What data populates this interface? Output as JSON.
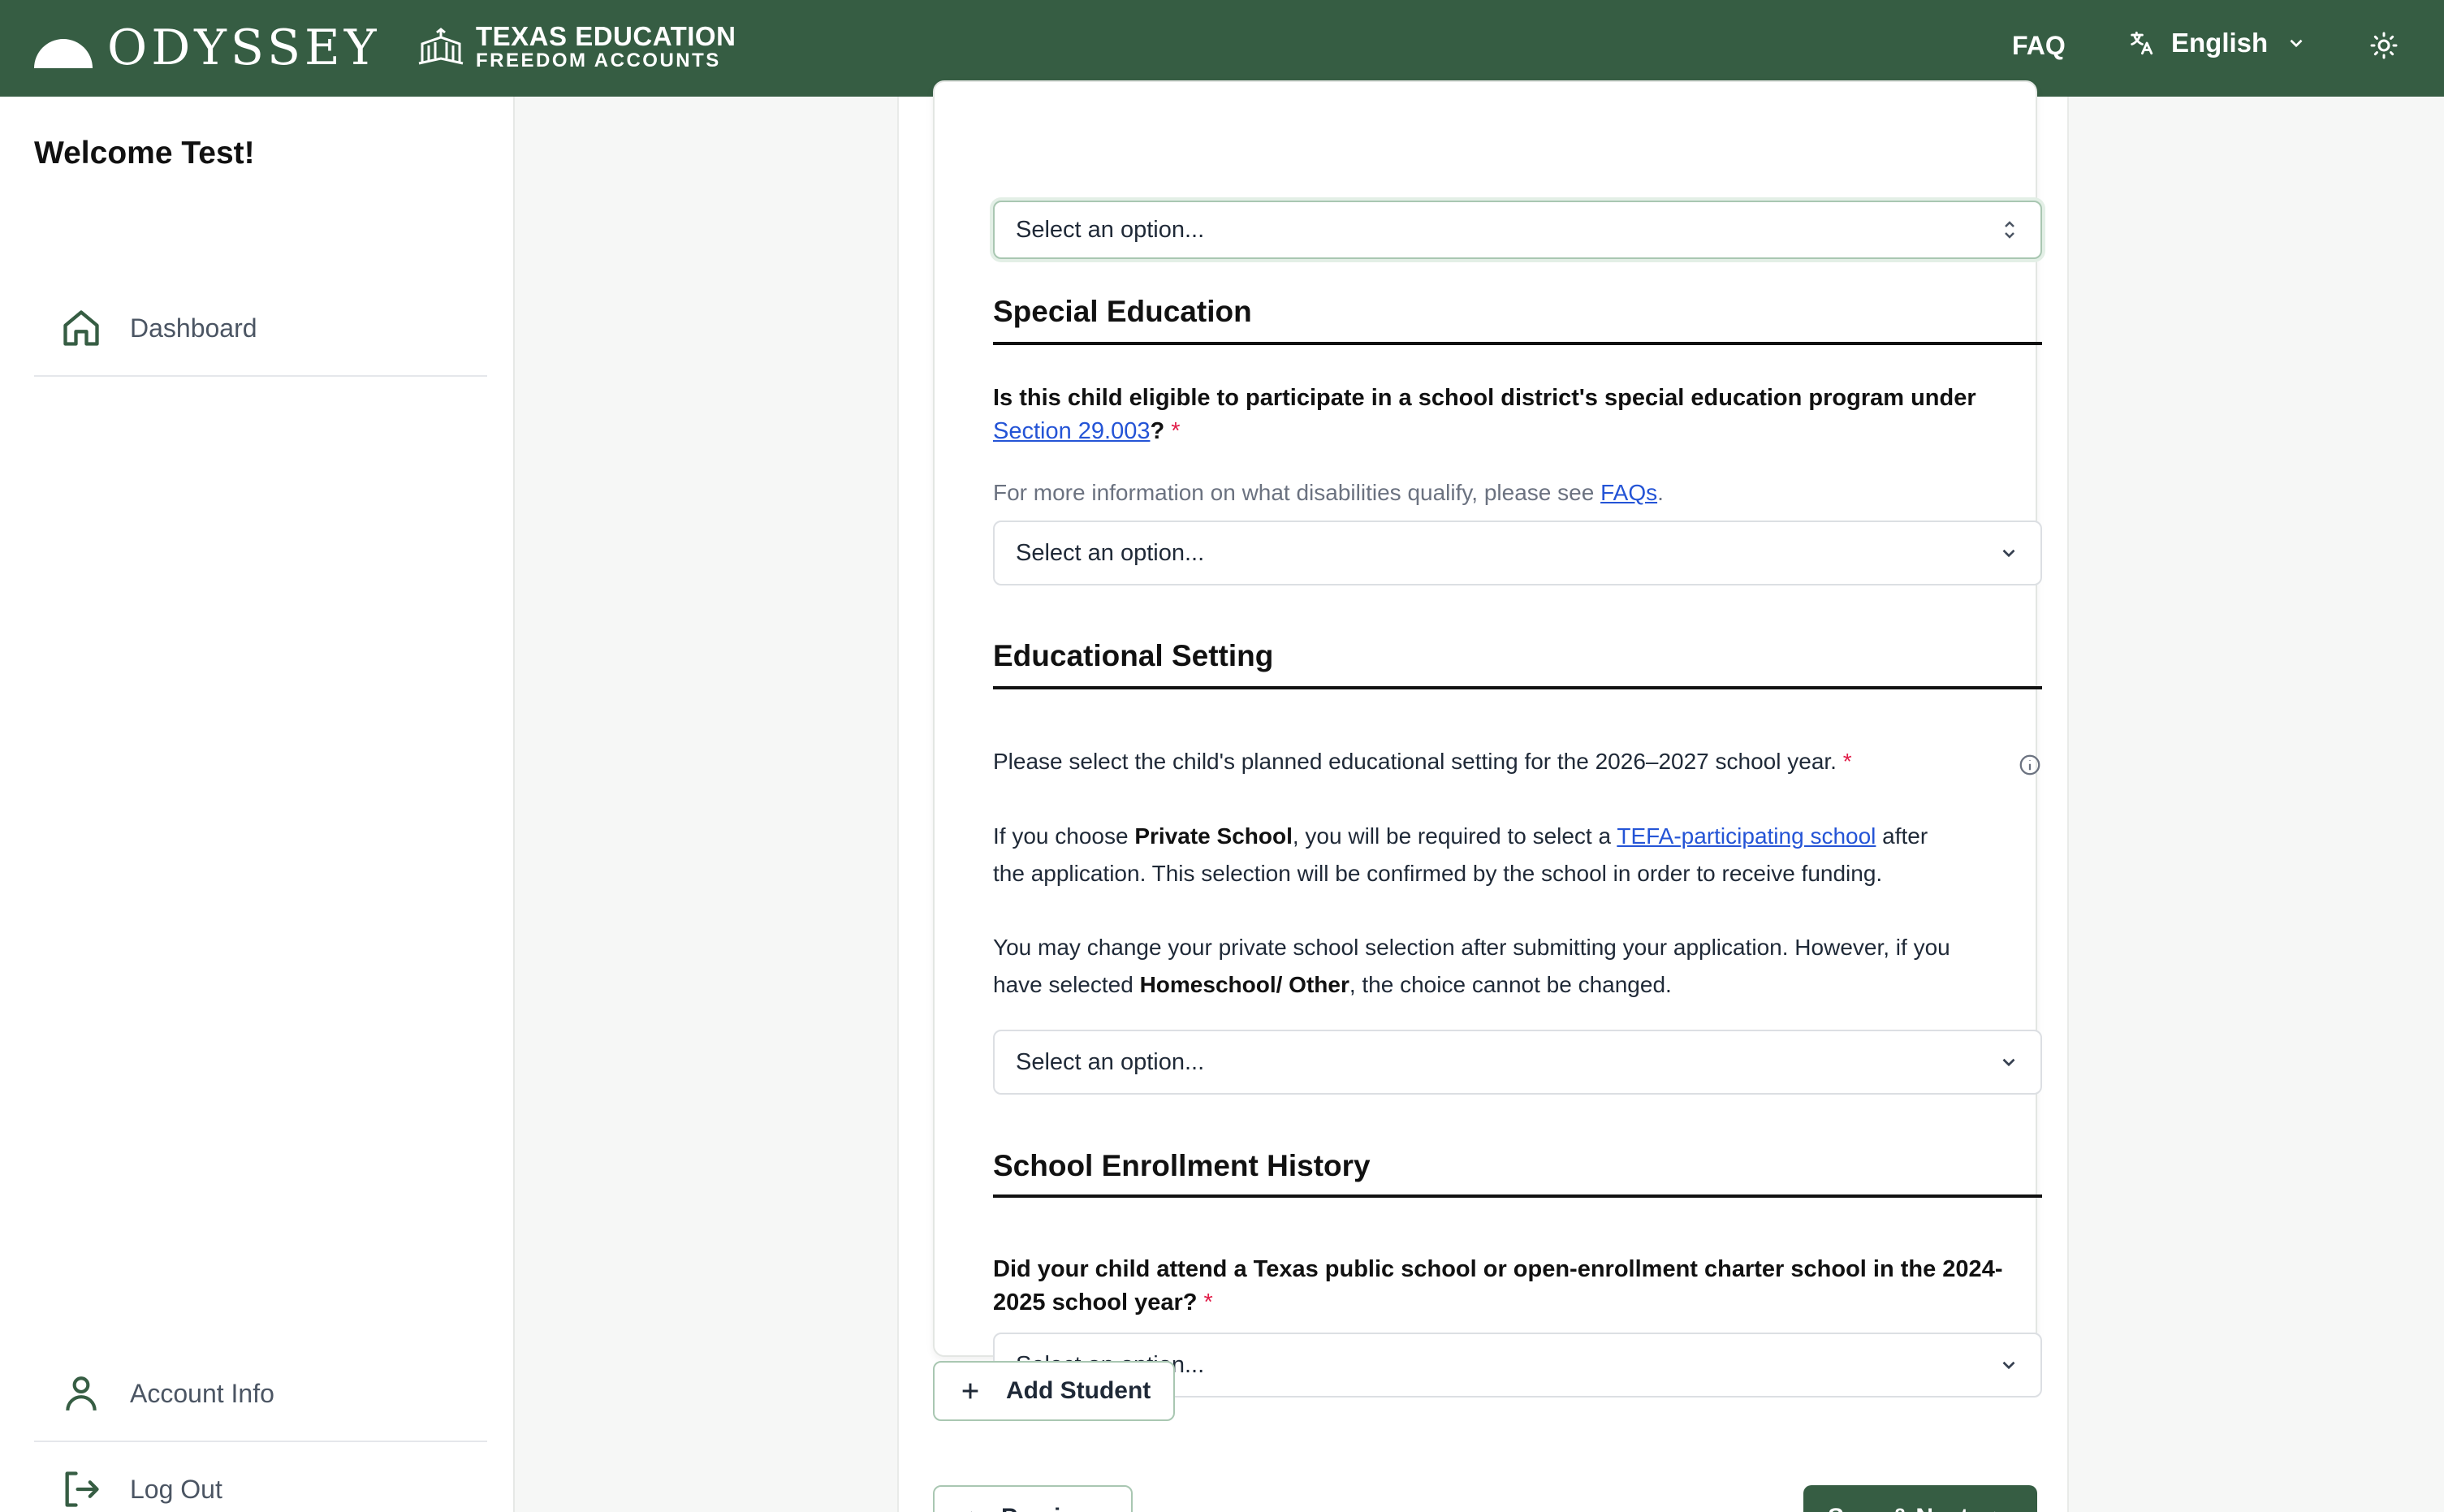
{
  "header": {
    "logo_text": "ODYSSEY",
    "tefa_line1": "TEXAS EDUCATION",
    "tefa_line2": "FREEDOM ACCOUNTS",
    "faq": "FAQ",
    "language": "English",
    "brand_color": "#365d43"
  },
  "sidebar": {
    "welcome": "Welcome Test!",
    "dashboard": "Dashboard",
    "account_info": "Account Info",
    "log_out": "Log Out"
  },
  "form": {
    "top_select": "Select an option...",
    "special_ed": {
      "heading": "Special Education",
      "question_pre": "Is this child eligible to participate in a school district's special education program under ",
      "question_link": "Section 29.003",
      "question_post": "?",
      "required_mark": "*",
      "help_pre": "For more information on what disabilities qualify, please see ",
      "help_link": "FAQs",
      "help_post": ".",
      "select": "Select an option..."
    },
    "edu_setting": {
      "heading": "Educational Setting",
      "question": "Please select the child's planned educational setting for the 2026–2027 school year.",
      "required_mark": "*",
      "p1_a": "If you choose ",
      "p1_b": "Private School",
      "p1_c": ", you will be required to select a ",
      "p1_link": "TEFA-participating school",
      "p1_d": " after",
      "p1_e": "the application. This selection will be confirmed by the school in order to receive funding.",
      "p2_a": "You may change your private school selection after submitting your application. However, if you",
      "p2_b": "have selected ",
      "p2_c": "Homeschool/ Other",
      "p2_d": ", the choice cannot be changed.",
      "select": "Select an option..."
    },
    "enrollment": {
      "heading": "School Enrollment History",
      "question": "Did your child attend a Texas public school or open-enrollment charter school in the 2024-2025 school year?",
      "required_mark": "*",
      "select": "Select an option..."
    }
  },
  "actions": {
    "add_student": "Add Student",
    "previous": "Previous",
    "save_next": "Save & Next"
  }
}
